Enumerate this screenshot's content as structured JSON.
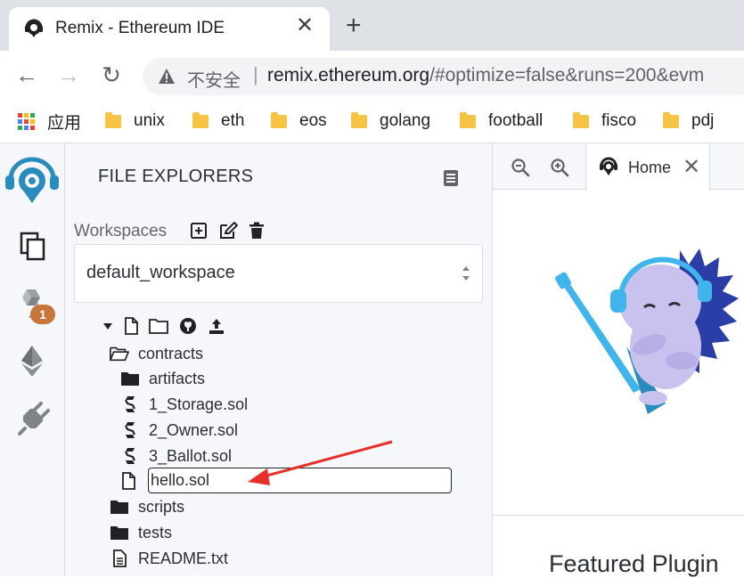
{
  "browser": {
    "tab_title": "Remix - Ethereum IDE",
    "tab_close": "✕",
    "new_tab": "+",
    "back": "←",
    "forward": "→",
    "reload": "↻",
    "insecure_label": "不安全",
    "url_host": "remix.ethereum.org",
    "url_rest": "/#optimize=false&runs=200&evm"
  },
  "bookmarks": {
    "apps_label": "应用",
    "folders": [
      "unix",
      "eth",
      "eos",
      "golang",
      "football",
      "fisco",
      "pdj"
    ]
  },
  "iconbar": {
    "compiler_badge": "1",
    "items": [
      "remix-logo-icon",
      "file-explorer-icon",
      "solidity-compiler-icon",
      "deploy-run-icon",
      "plugin-manager-icon"
    ]
  },
  "file_explorer": {
    "title": "FILE EXPLORERS",
    "workspaces_label": "Workspaces",
    "workspace_selected": "default_workspace",
    "tree": {
      "contracts": "contracts",
      "artifacts": "artifacts",
      "files": [
        "1_Storage.sol",
        "2_Owner.sol",
        "3_Ballot.sol"
      ],
      "new_file_value": "hello.sol",
      "scripts": "scripts",
      "tests": "tests",
      "readme": "README.txt"
    }
  },
  "main": {
    "home_tab_label": "Home",
    "featured_heading": "Featured Plugin"
  },
  "colors": {
    "accent_blue": "#2a8bbf",
    "annotation_arrow": "#e8302b",
    "badge": "#c97539"
  }
}
